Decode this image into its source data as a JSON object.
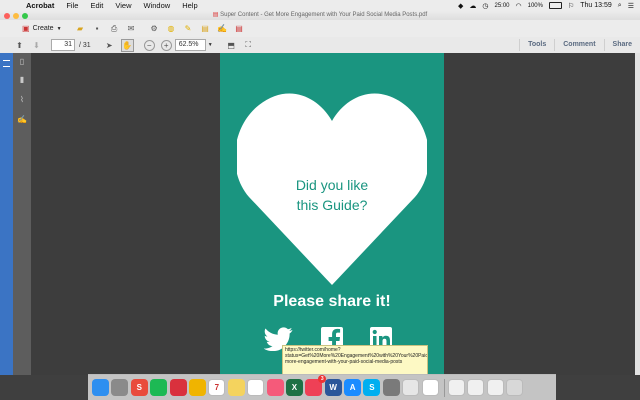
{
  "menubar": {
    "app": "Acrobat",
    "items": [
      "File",
      "Edit",
      "View",
      "Window",
      "Help"
    ],
    "battery": "100%",
    "clock": "Thu 13:59",
    "status_time": "25:00"
  },
  "window": {
    "title": "Super Content - Get More Engagement with Your Paid Social Media Posts.pdf"
  },
  "toolbar": {
    "create_label": "Create",
    "page_current": "31",
    "page_total": "/ 31",
    "zoom": "62.5%",
    "tools_label": "Tools",
    "comment_label": "Comment",
    "share_label": "Share"
  },
  "page": {
    "heart_line1": "Did you like",
    "heart_line2": "this Guide?",
    "share_text": "Please share it!",
    "background": "#1a9580"
  },
  "tooltip": {
    "text": "https://twitter.com/home?status=Get%20More%20Engagement%20with%20Your%20Paid%20Social%20Media%20Posts%20http%3A//www.momentum.ai/get-more-engagement-with-your-paid-social-media-posts"
  },
  "dock": {
    "apps": [
      {
        "name": "finder",
        "color": "#2d8ff0",
        "glyph": ""
      },
      {
        "name": "launchpad",
        "color": "#8a8a8a",
        "glyph": ""
      },
      {
        "name": "app-s",
        "color": "#e94b3c",
        "glyph": "S"
      },
      {
        "name": "spotify",
        "color": "#1db954",
        "glyph": ""
      },
      {
        "name": "bookmark",
        "color": "#d9313d",
        "glyph": ""
      },
      {
        "name": "chrome",
        "color": "#f0b400",
        "glyph": ""
      },
      {
        "name": "calendar",
        "color": "#ffffff",
        "glyph": "7"
      },
      {
        "name": "notes",
        "color": "#f4d35e",
        "glyph": ""
      },
      {
        "name": "photos",
        "color": "#ffffff",
        "glyph": ""
      },
      {
        "name": "music",
        "color": "#f55a7a",
        "glyph": ""
      },
      {
        "name": "excel",
        "color": "#1e7145",
        "glyph": "X"
      },
      {
        "name": "pocket",
        "color": "#ef4056",
        "glyph": ""
      },
      {
        "name": "word",
        "color": "#2b579a",
        "glyph": "W"
      },
      {
        "name": "app-store",
        "color": "#1a8cff",
        "glyph": "A"
      },
      {
        "name": "skype",
        "color": "#00aff0",
        "glyph": "S"
      },
      {
        "name": "preferences",
        "color": "#7a7a7a",
        "glyph": ""
      },
      {
        "name": "safari",
        "color": "#e6e6e6",
        "glyph": ""
      },
      {
        "name": "acrobat",
        "color": "#ffffff",
        "glyph": ""
      },
      {
        "name": "document",
        "color": "#f0f0f0",
        "glyph": ""
      },
      {
        "name": "document2",
        "color": "#f0f0f0",
        "glyph": ""
      },
      {
        "name": "folder",
        "color": "#f0f0f0",
        "glyph": ""
      },
      {
        "name": "trash",
        "color": "#d8d8d8",
        "glyph": ""
      }
    ],
    "badge": "3"
  }
}
